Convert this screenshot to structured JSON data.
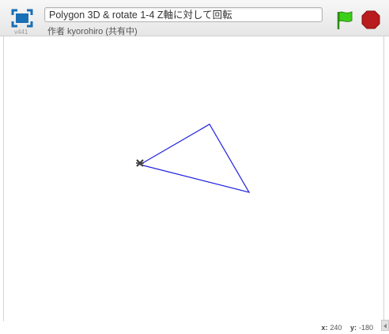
{
  "header": {
    "project_title": "Polygon 3D & rotate 1-4 Z軸に対して回転",
    "author": "作者 kyorohiro (共有中)",
    "version": "v441"
  },
  "icons": {
    "fullscreen": "fullscreen-icon",
    "green_flag": "green-flag-icon",
    "stop": "stop-icon"
  },
  "stage": {
    "sprite": "sprite-costume",
    "triangle_color": "#2020e0"
  },
  "status": {
    "x_label": "x:",
    "x_value": "240",
    "y_label": "y:",
    "y_value": "-180"
  },
  "colors": {
    "flag_green": "#3ccf1a",
    "stop_red": "#b81c1c"
  }
}
